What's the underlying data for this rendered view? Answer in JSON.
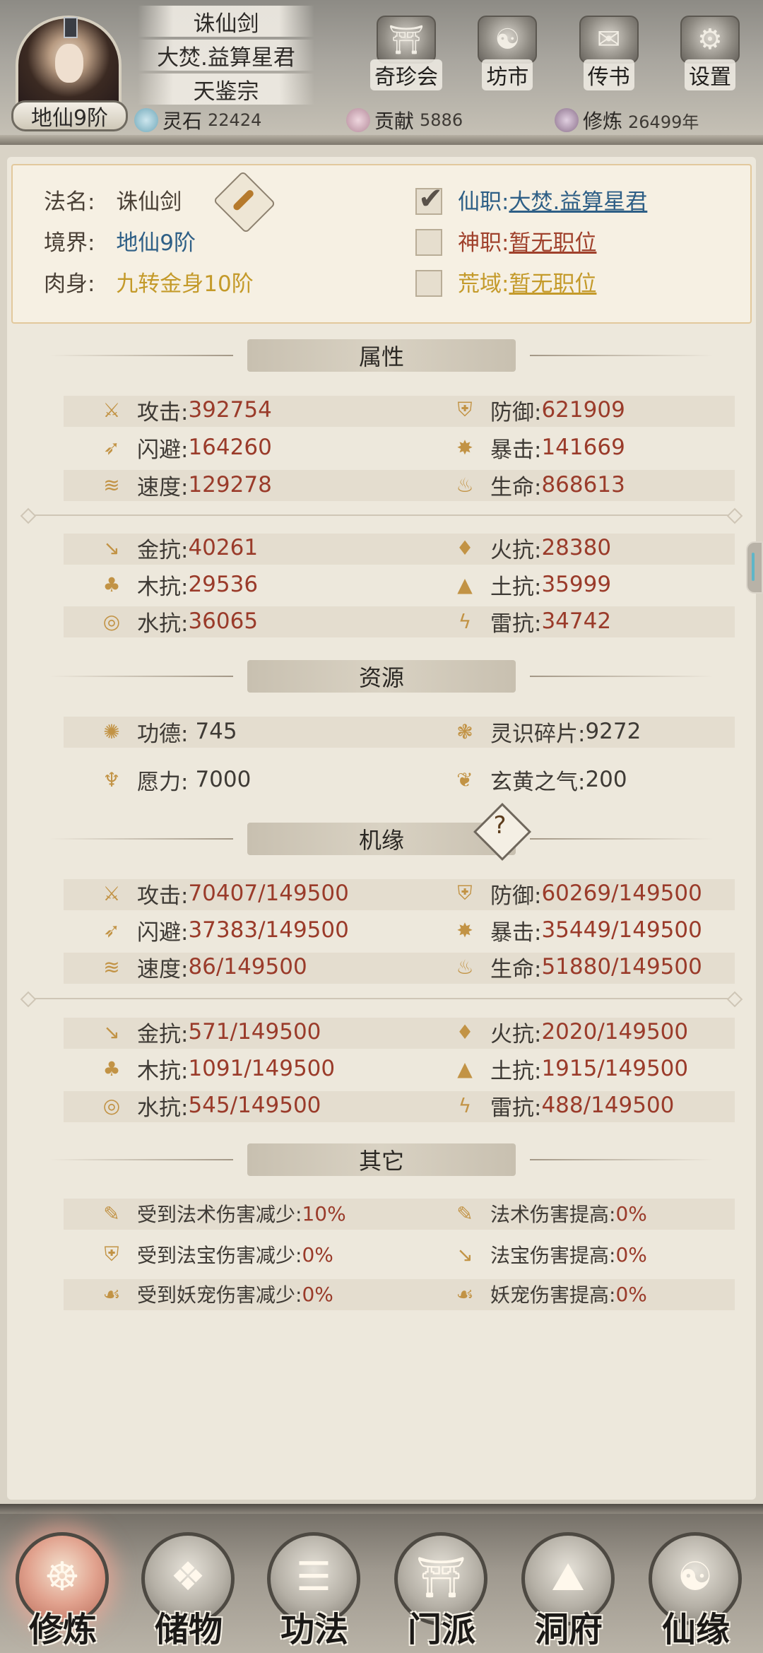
{
  "header": {
    "realm_badge": "地仙9阶",
    "titles": [
      "诛仙剑",
      "大焚.益算星君",
      "天鉴宗"
    ],
    "nav": [
      {
        "label": "奇珍会",
        "icon": "pavilion-icon"
      },
      {
        "label": "坊市",
        "icon": "market-icon"
      },
      {
        "label": "传书",
        "icon": "scroll-icon"
      },
      {
        "label": "设置",
        "icon": "gear-icon"
      }
    ],
    "resources": [
      {
        "label": "灵石",
        "value": "22424",
        "icon": "spirit-stone-icon",
        "color": "#6fa7b8"
      },
      {
        "label": "贡献",
        "value": "5886",
        "icon": "contribution-icon",
        "color": "#b48a9a"
      },
      {
        "label": "修炼",
        "value": "26499年",
        "icon": "cultivation-icon",
        "color": "#8a6f8a"
      }
    ]
  },
  "profile": {
    "name_label": "法名:",
    "name_value": "诛仙剑",
    "realm_label": "境界:",
    "realm_value": "地仙9阶",
    "body_label": "肉身:",
    "body_value": "九转金身10阶",
    "xianzhi_label": "仙职:",
    "xianzhi_value": "大焚.益算星君",
    "shenzhi_label": "神职:",
    "shenzhi_value": "暂无职位",
    "huangyu_label": "荒域:",
    "huangyu_value": "暂无职位"
  },
  "sections": {
    "attributes": "属性",
    "resources": "资源",
    "fortune": "机缘",
    "other": "其它"
  },
  "attributes": [
    {
      "label": "攻击:",
      "value": "392754"
    },
    {
      "label": "防御:",
      "value": "621909"
    },
    {
      "label": "闪避:",
      "value": "164260"
    },
    {
      "label": "暴击:",
      "value": "141669"
    },
    {
      "label": "速度:",
      "value": "129278"
    },
    {
      "label": "生命:",
      "value": "868613"
    }
  ],
  "resistances": [
    {
      "label": "金抗:",
      "value": "40261"
    },
    {
      "label": "火抗:",
      "value": "28380"
    },
    {
      "label": "木抗:",
      "value": "29536"
    },
    {
      "label": "土抗:",
      "value": "35999"
    },
    {
      "label": "水抗:",
      "value": "36065"
    },
    {
      "label": "雷抗:",
      "value": "34742"
    }
  ],
  "resource_items": [
    {
      "label": "功德:",
      "value": "745"
    },
    {
      "label": "灵识碎片:",
      "value": "9272"
    },
    {
      "label": "愿力:",
      "value": "7000"
    },
    {
      "label": "玄黄之气:",
      "value": "200"
    }
  ],
  "fortune_button": "?",
  "fortune_attributes": [
    {
      "label": "攻击:",
      "value": "70407/149500"
    },
    {
      "label": "防御:",
      "value": "60269/149500"
    },
    {
      "label": "闪避:",
      "value": "37383/149500"
    },
    {
      "label": "暴击:",
      "value": "35449/149500"
    },
    {
      "label": "速度:",
      "value": "86/149500"
    },
    {
      "label": "生命:",
      "value": "51880/149500"
    }
  ],
  "fortune_resistances": [
    {
      "label": "金抗:",
      "value": "571/149500"
    },
    {
      "label": "火抗:",
      "value": "2020/149500"
    },
    {
      "label": "木抗:",
      "value": "1091/149500"
    },
    {
      "label": "土抗:",
      "value": "1915/149500"
    },
    {
      "label": "水抗:",
      "value": "545/149500"
    },
    {
      "label": "雷抗:",
      "value": "488/149500"
    }
  ],
  "other": [
    {
      "label": "受到法术伤害减少:",
      "value": "10%"
    },
    {
      "label": "法术伤害提高:",
      "value": "0%"
    },
    {
      "label": "受到法宝伤害减少:",
      "value": "0%"
    },
    {
      "label": "法宝伤害提高:",
      "value": "0%"
    },
    {
      "label": "受到妖宠伤害减少:",
      "value": "0%"
    },
    {
      "label": "妖宠伤害提高:",
      "value": "0%"
    }
  ],
  "bottom_nav": [
    {
      "label": "修炼",
      "icon": "sage-icon",
      "active": true
    },
    {
      "label": "储物",
      "icon": "pouch-icon"
    },
    {
      "label": "功法",
      "icon": "manual-icon"
    },
    {
      "label": "门派",
      "icon": "sect-gate-icon"
    },
    {
      "label": "洞府",
      "icon": "cave-mansion-icon"
    },
    {
      "label": "仙缘",
      "icon": "taiji-icon"
    }
  ]
}
